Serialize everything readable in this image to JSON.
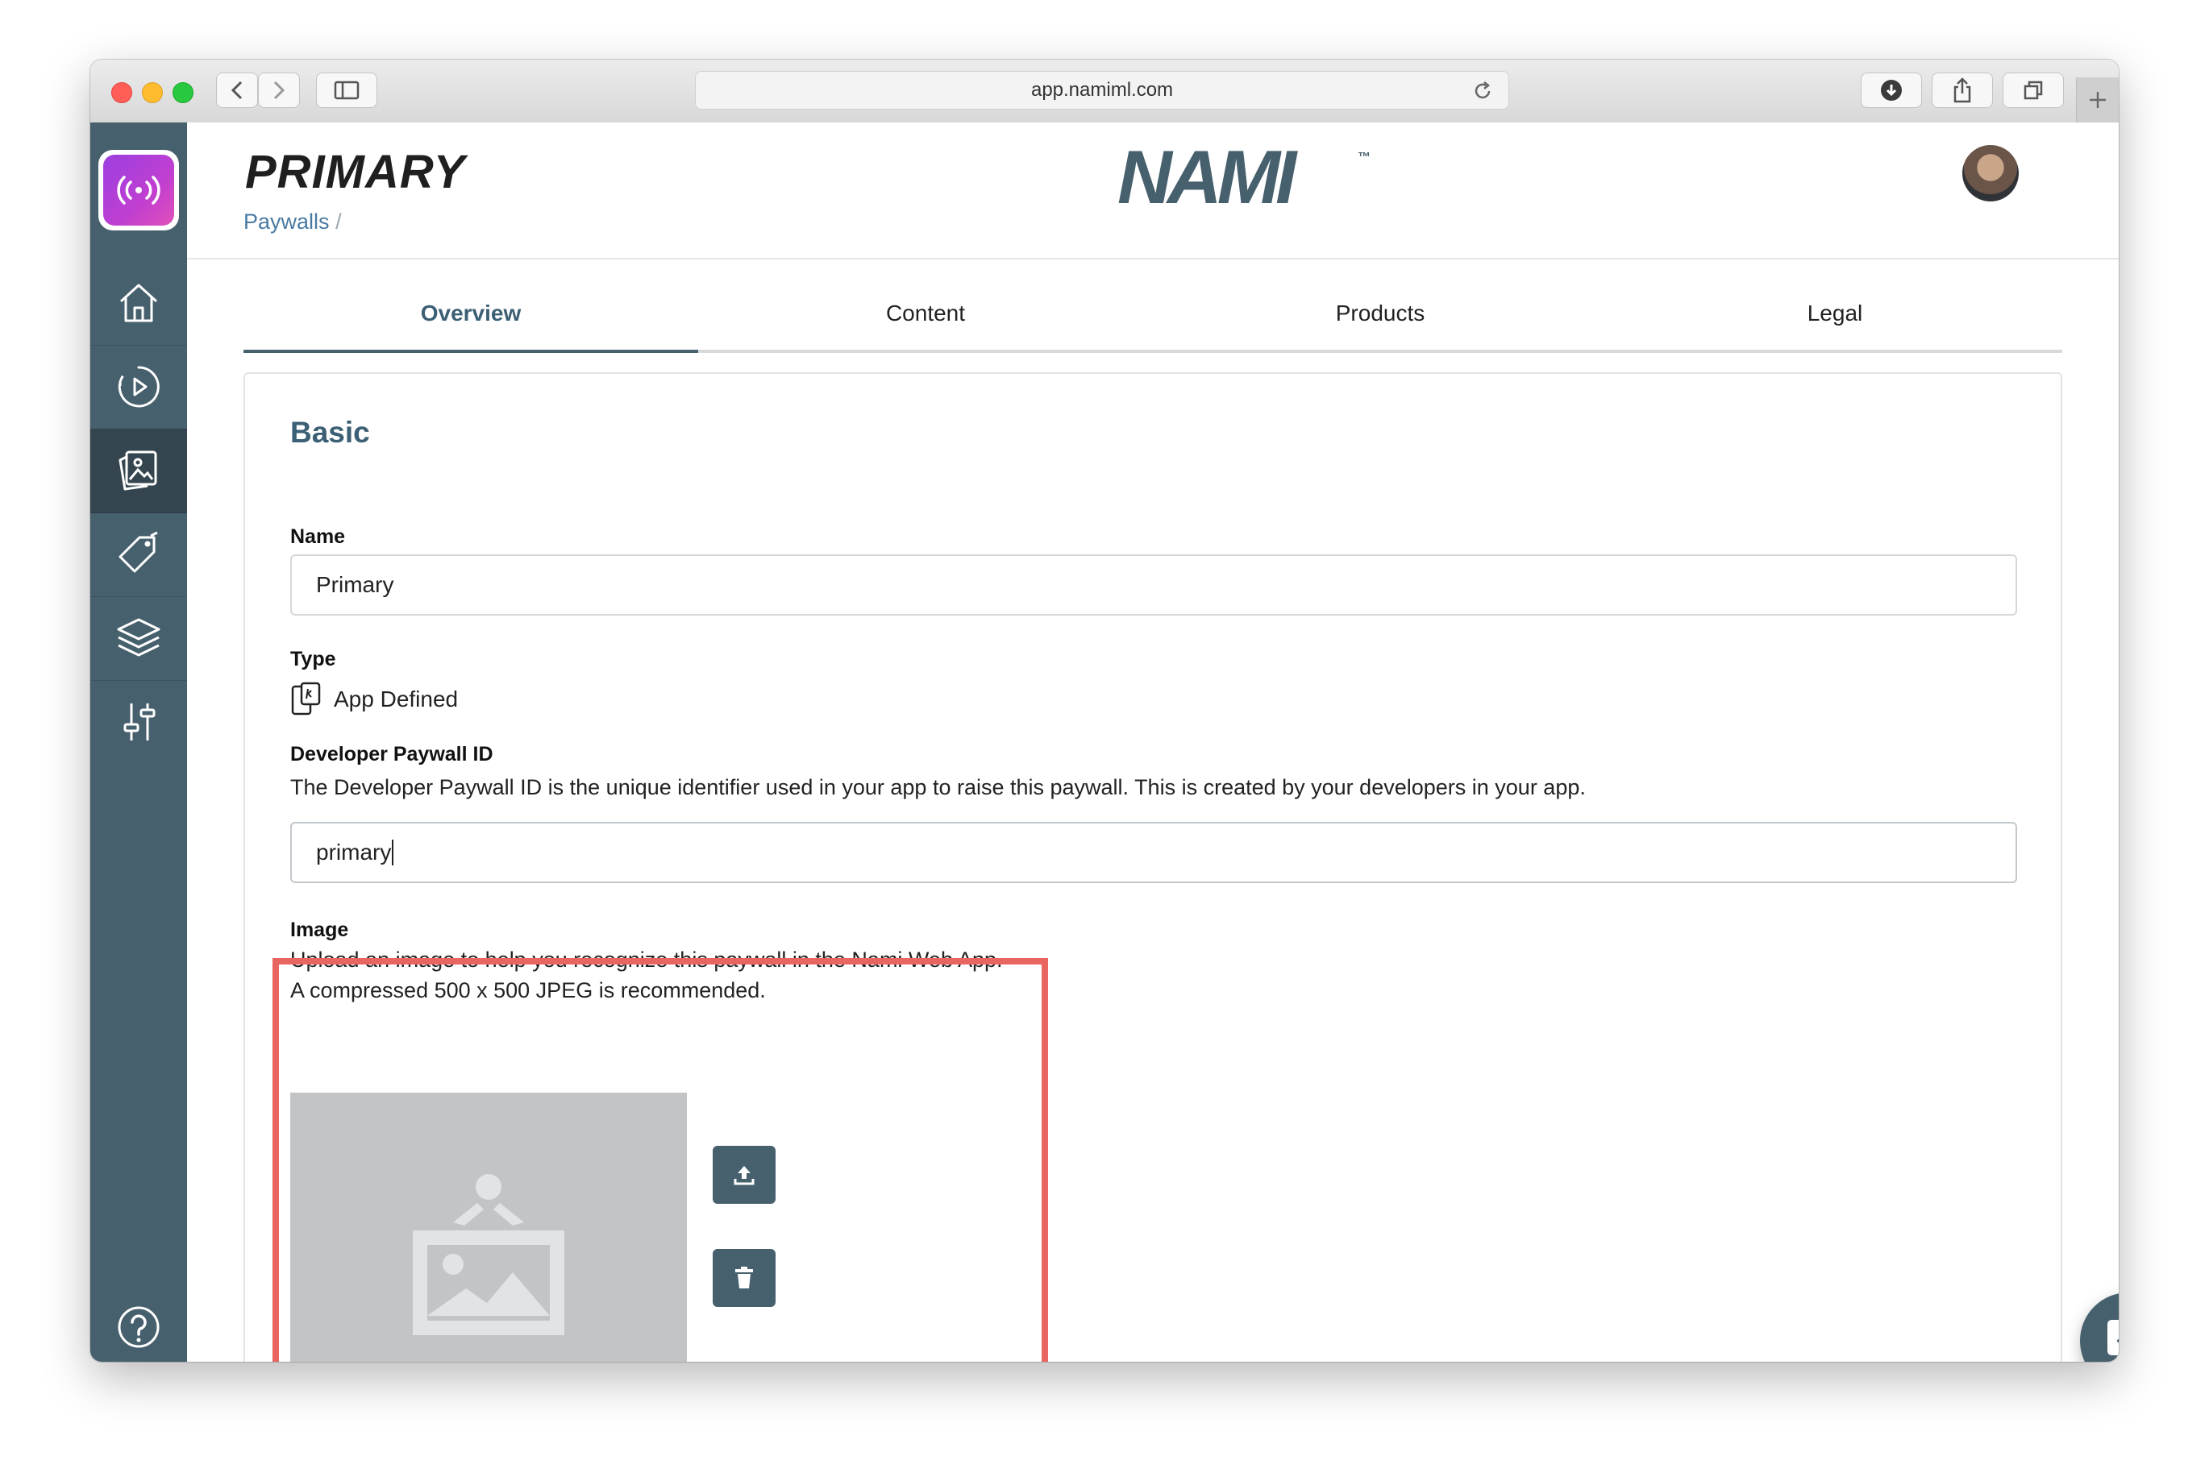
{
  "browser": {
    "url": "app.namiml.com"
  },
  "header": {
    "title": "PRIMARY",
    "breadcrumb_link": "Paywalls",
    "breadcrumb_separator": "/",
    "brand": "NAMI",
    "brand_mark": "™"
  },
  "tabs": [
    {
      "label": "Overview",
      "active": true
    },
    {
      "label": "Content",
      "active": false
    },
    {
      "label": "Products",
      "active": false
    },
    {
      "label": "Legal",
      "active": false
    }
  ],
  "sidebar": {
    "items": [
      {
        "icon": "home-icon",
        "active": false
      },
      {
        "icon": "analytics-play-icon",
        "active": false
      },
      {
        "icon": "paywalls-cards-icon",
        "active": true
      },
      {
        "icon": "tag-icon",
        "active": false
      },
      {
        "icon": "layers-icon",
        "active": false
      },
      {
        "icon": "settings-sliders-icon",
        "active": false
      }
    ],
    "help_icon": "help-icon"
  },
  "form": {
    "section_title": "Basic",
    "name_label": "Name",
    "name_value": "Primary",
    "type_label": "Type",
    "type_value": "App Defined",
    "dev_id_label": "Developer Paywall ID",
    "dev_id_help": "The Developer Paywall ID is the unique identifier used in your app to raise this paywall. This is created by your developers in your app.",
    "dev_id_value": "primary",
    "image_label": "Image",
    "image_help_line1": "Upload an image to help you recognize this paywall in the Nami Web App.",
    "image_help_line2": "A compressed 500 x 500 JPEG is recommended."
  },
  "colors": {
    "sidebar": "#47606d",
    "accent": "#3b5f74",
    "link": "#4a7aa3",
    "highlight": "#e8665f"
  }
}
